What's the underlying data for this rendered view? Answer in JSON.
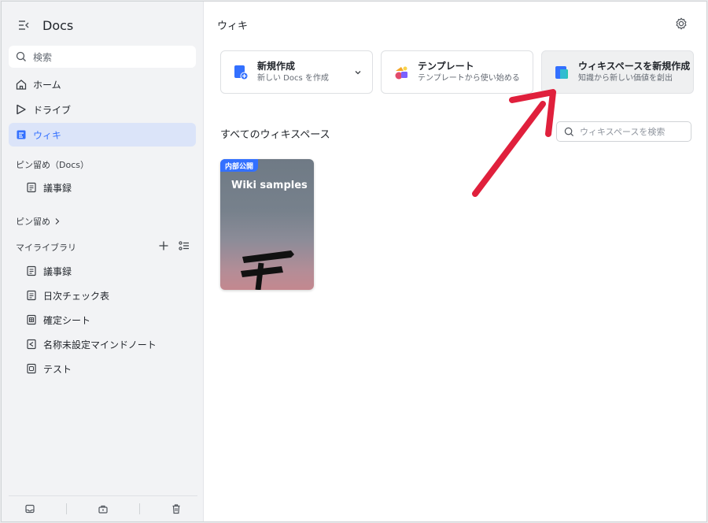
{
  "app": {
    "title": "Docs"
  },
  "search": {
    "placeholder": "検索"
  },
  "nav": [
    {
      "label": "ホーム",
      "icon": "home-icon"
    },
    {
      "label": "ドライブ",
      "icon": "drive-icon"
    },
    {
      "label": "ウィキ",
      "icon": "wiki-icon",
      "active": true
    }
  ],
  "pinned_docs": {
    "label": "ピン留め（Docs）",
    "items": [
      {
        "label": "議事録",
        "icon": "doc-icon"
      }
    ]
  },
  "pinned": {
    "label": "ピン留め"
  },
  "library": {
    "label": "マイライブラリ",
    "items": [
      {
        "label": "議事録",
        "icon": "doc-icon"
      },
      {
        "label": "日次チェック表",
        "icon": "doc-icon"
      },
      {
        "label": "確定シート",
        "icon": "sheet-icon"
      },
      {
        "label": "名称未設定マインドノート",
        "icon": "mindnote-icon"
      },
      {
        "label": "テスト",
        "icon": "form-icon"
      }
    ]
  },
  "main": {
    "title": "ウィキ",
    "actions": [
      {
        "title": "新規作成",
        "subtitle": "新しい Docs を作成",
        "icon": "new-doc-icon"
      },
      {
        "title": "テンプレート",
        "subtitle": "テンプレートから使い始める",
        "icon": "template-icon"
      },
      {
        "title": "ウィキスペースを新規作成",
        "subtitle": "知識から新しい価値を創出",
        "icon": "wiki-space-icon"
      }
    ],
    "section_title": "すべてのウィキスペース",
    "wiki_search_placeholder": "ウィキスペースを検索",
    "wiki_cards": [
      {
        "badge": "内部公開",
        "name": "Wiki samples"
      }
    ]
  },
  "colors": {
    "accent": "#3370ff",
    "annotation_arrow": "#e0203c"
  }
}
